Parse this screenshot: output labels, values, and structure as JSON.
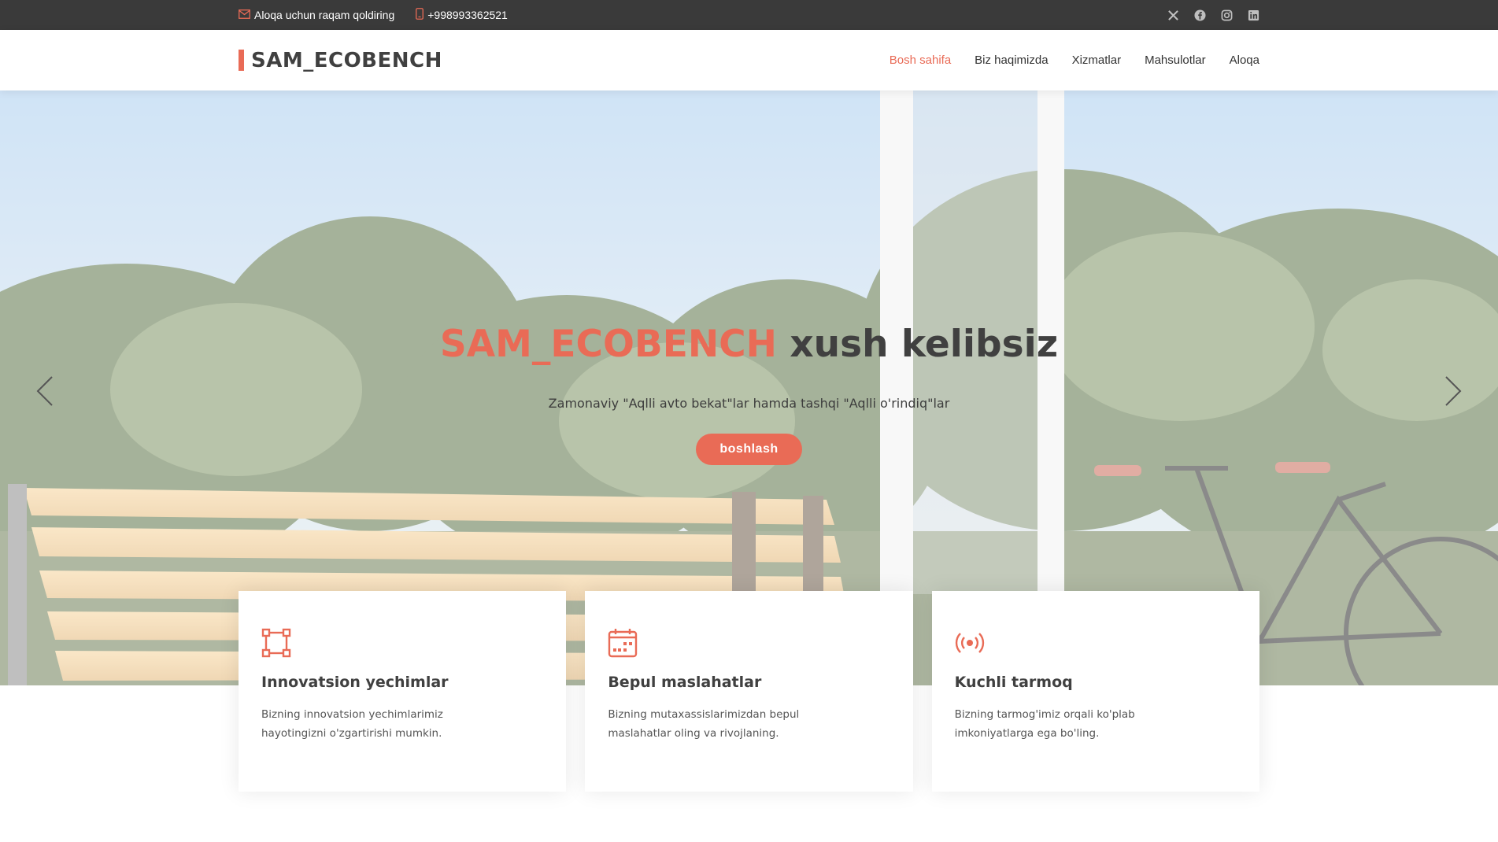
{
  "topbar": {
    "email_text": "Aloqa uchun raqam qoldiring",
    "phone_text": "+998993362521",
    "socials": [
      "x-icon",
      "facebook-icon",
      "instagram-icon",
      "linkedin-icon"
    ]
  },
  "header": {
    "logo_text": "SAM_ECOBENCH",
    "nav": [
      {
        "label": "Bosh sahifa",
        "active": true
      },
      {
        "label": "Biz haqimizda",
        "active": false
      },
      {
        "label": "Xizmatlar",
        "active": false
      },
      {
        "label": "Mahsulotlar",
        "active": false
      },
      {
        "label": "Aloqa",
        "active": false
      }
    ]
  },
  "hero": {
    "title_accent": "SAM_ECOBENCH",
    "title_rest": " xush kelibsiz",
    "subtitle": "Zamonaviy \"Aqlli avto bekat\"lar hamda tashqi \"Aqlli o'rindiq\"lar",
    "button_label": "boshlash"
  },
  "cards": [
    {
      "icon": "bounding-box-icon",
      "title": "Innovatsion yechimlar",
      "text": "Bizning innovatsion yechimlarimiz hayotingizni o'zgartirishi mumkin."
    },
    {
      "icon": "calendar-icon",
      "title": "Bepul maslahatlar",
      "text": "Bizning mutaxassislarimizdan bepul maslahatlar oling va rivojlaning."
    },
    {
      "icon": "broadcast-icon",
      "title": "Kuchli tarmoq",
      "text": "Bizning tarmog'imiz orqali ko'plab imkoniyatlarga ega bo'ling."
    }
  ],
  "colors": {
    "accent": "#e96b56",
    "topbar": "#3a3a3a",
    "text_dark": "#404040"
  }
}
